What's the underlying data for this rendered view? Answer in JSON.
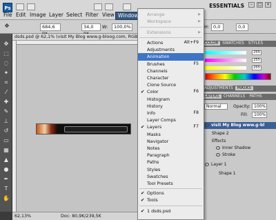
{
  "app": {
    "logo": "Ps",
    "workspace": "ESSENTIALS"
  },
  "menubar": {
    "items": [
      "File",
      "Edit",
      "Image",
      "Layer",
      "Select",
      "Filter",
      "View",
      "Window"
    ]
  },
  "options": {
    "x_value": "684,6 px",
    "y_value": "34,0 px",
    "w_label": "W:",
    "w_value": "100,0%",
    "h_label": "H:",
    "h_value": "0,0",
    "v_value": "0,0"
  },
  "document": {
    "tab_title": "dsds.psd @ 62,1% (visit My Blog   www.g-bloog.com, RGB/",
    "zoom": "62,13%",
    "doc_info": "Doc: 80,9K/239,5K"
  },
  "panels": {
    "color_tab": "COLOR",
    "swatches_tab": "SWATCHES",
    "styles_tab": "STYLES",
    "slider_values": [
      "255",
      "255",
      "255"
    ],
    "adjustments_tab": "ADJUSTMENTS",
    "masks_tab": "MASKS",
    "layers_tab": "LAYERS",
    "channels_tab": "CHANNELS",
    "paths_tab": "PATHS",
    "blend_mode": "Normal",
    "opacity_label": "Opacity:",
    "opacity_value": "100%",
    "fill_label": "Fill:",
    "fill_value": "100%"
  },
  "layers": [
    {
      "name": "visit My Blog     www.g-bl",
      "selected": true
    },
    {
      "name": "Shape 2",
      "selected": false
    },
    {
      "name": "Effects",
      "selected": false
    },
    {
      "name": "Inner Shadow",
      "selected": false
    },
    {
      "name": "Stroke",
      "selected": false
    },
    {
      "name": "Layer 1",
      "selected": false
    },
    {
      "name": "Shape 1",
      "selected": false
    }
  ],
  "window_menu": {
    "items": [
      {
        "label": "Arrange",
        "disabled": true,
        "submenu": true
      },
      {
        "label": "Workspace",
        "disabled": true,
        "submenu": true
      },
      {
        "label": "Extensions",
        "disabled": true,
        "submenu": true
      },
      {
        "label": "Actions",
        "shortcut": "Alt+F9"
      },
      {
        "label": "Adjustments"
      },
      {
        "label": "Animation",
        "highlighted": true
      },
      {
        "label": "Brushes",
        "shortcut": "F5"
      },
      {
        "label": "Channels"
      },
      {
        "label": "Character"
      },
      {
        "label": "Clone Source"
      },
      {
        "label": "Color",
        "checked": true,
        "shortcut": "F6"
      },
      {
        "label": "Histogram"
      },
      {
        "label": "History"
      },
      {
        "label": "Info",
        "shortcut": "F8"
      },
      {
        "label": "Layer Comps"
      },
      {
        "label": "Layers",
        "checked": true,
        "shortcut": "F7"
      },
      {
        "label": "Masks"
      },
      {
        "label": "Navigator"
      },
      {
        "label": "Notes"
      },
      {
        "label": "Paragraph"
      },
      {
        "label": "Paths"
      },
      {
        "label": "Styles"
      },
      {
        "label": "Swatches"
      },
      {
        "label": "Tool Presets"
      },
      {
        "label": "Options",
        "checked": true
      },
      {
        "label": "Tools",
        "checked": true
      },
      {
        "label": "1 dsds.psd",
        "checked": true
      }
    ]
  }
}
